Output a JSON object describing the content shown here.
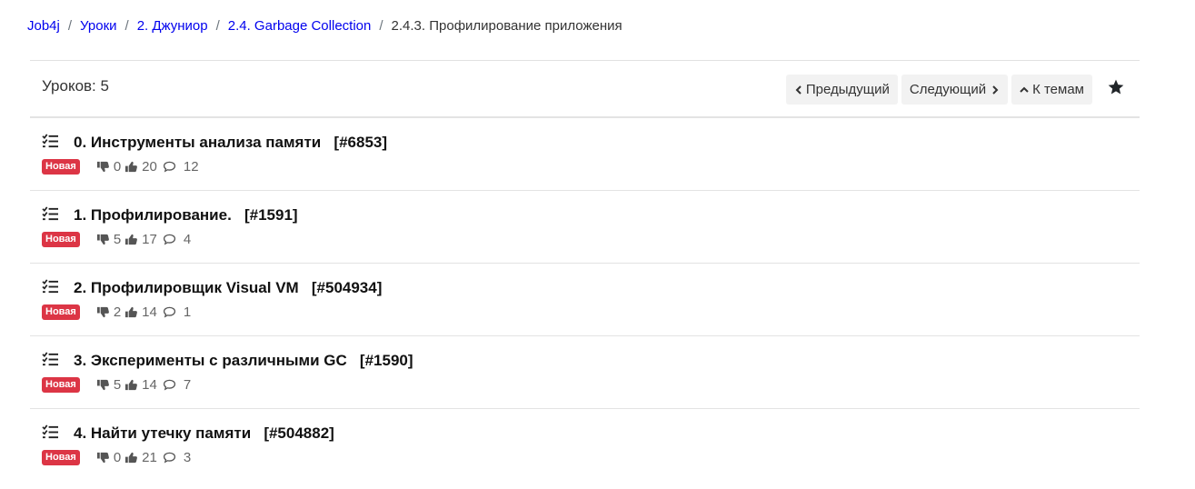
{
  "breadcrumb": {
    "items": [
      "Job4j",
      "Уроки",
      "2. Джуниор",
      "2.4. Garbage Collection"
    ],
    "current": "2.4.3. Профилирование приложения"
  },
  "header": {
    "lessons_count": "Уроков: 5",
    "prev_label": "Предыдущий",
    "next_label": "Следующий",
    "topics_label": "К темам"
  },
  "lessons": [
    {
      "title": "0. Инструменты анализа памяти   [#6853]",
      "badge": "Новая",
      "dislikes": "0",
      "likes": "20",
      "comments": "12"
    },
    {
      "title": "1. Профилирование.   [#1591]",
      "badge": "Новая",
      "dislikes": "5",
      "likes": "17",
      "comments": "4"
    },
    {
      "title": "2. Профилировщик Visual VM   [#504934]",
      "badge": "Новая",
      "dislikes": "2",
      "likes": "14",
      "comments": "1"
    },
    {
      "title": "3. Эксперименты с различными GC   [#1590]",
      "badge": "Новая",
      "dislikes": "5",
      "likes": "14",
      "comments": "7"
    },
    {
      "title": "4. Найти утечку памяти   [#504882]",
      "badge": "Новая",
      "dislikes": "0",
      "likes": "21",
      "comments": "3"
    }
  ],
  "icons": {
    "lesson": "tasks-icon",
    "dislike": "thumbs-down-icon",
    "like": "thumbs-up-icon",
    "comments": "comments-icon",
    "favorite": "star-icon"
  },
  "colors": {
    "link": "#0000ee",
    "badge": "#dc3545",
    "button_bg": "#f2f2f2"
  }
}
